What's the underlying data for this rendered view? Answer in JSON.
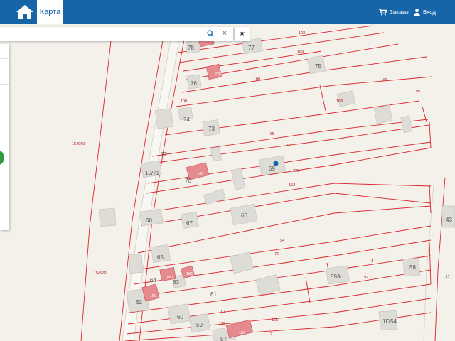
{
  "header": {
    "tab_map": "Карта",
    "orders": "Заказы",
    "login": "Вход",
    "home_icon": "home-icon",
    "cart_icon": "cart-icon",
    "user_icon": "user-icon",
    "brand_color": "#1565a8"
  },
  "search": {
    "value": "",
    "search_icon": "search-icon",
    "clear_icon": "close-icon",
    "clear_glyph": "×",
    "favorites_glyph": "★"
  },
  "map": {
    "boundary_color": "#d9262c",
    "highlight_color": "#e58a8f",
    "building_labels": [
      "78",
      "77",
      "75",
      "76",
      "74",
      "73",
      "72",
      "10/71",
      "70",
      "69",
      "68",
      "67",
      "66",
      "65",
      "64",
      "63",
      "62",
      "61",
      "60",
      "59",
      "59А",
      "58",
      "57",
      "1Г/54",
      "43",
      "37"
    ],
    "parcel_labels": [
      "102",
      "169",
      "100",
      "168",
      "95",
      "168",
      "100",
      "65",
      "32",
      "154960",
      "228",
      "152",
      "94",
      "76",
      "1",
      "92",
      "154961",
      "707",
      "195",
      "165",
      "2"
    ],
    "building_area_labels": [
      "228",
      "145",
      "180",
      "186",
      "159",
      "159"
    ]
  }
}
